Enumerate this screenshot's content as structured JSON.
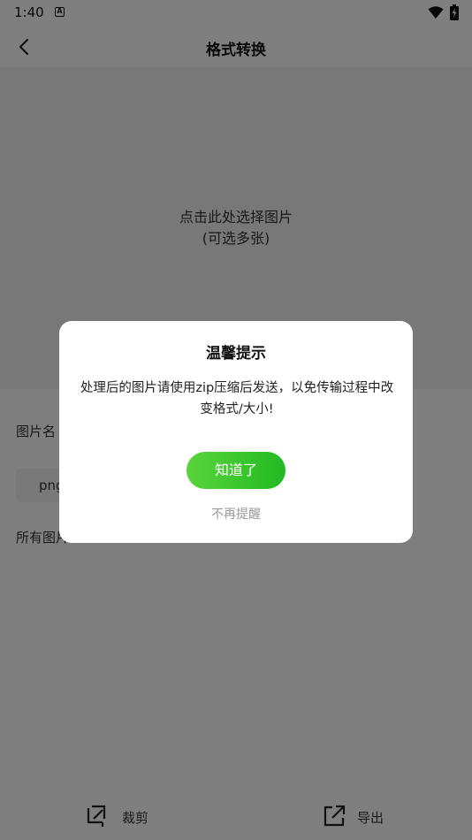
{
  "status_bar": {
    "time": "1:40",
    "notification_letter": "A"
  },
  "header": {
    "title": "格式转换",
    "back_icon": "chevron-left-icon"
  },
  "picker": {
    "line1": "点击此处选择图片",
    "line2": "(可选多张)"
  },
  "settings": {
    "image_name_label": "图片名",
    "format_value": "png",
    "all_images_label": "所有图片"
  },
  "bottom_bar": {
    "crop_label": "裁剪",
    "export_label": "导出"
  },
  "dialog": {
    "title": "温馨提示",
    "message": "处理后的图片请使用zip压缩后发送，以免传输过程中改变格式/大小!",
    "ok_label": "知道了",
    "no_remind_label": "不再提醒"
  },
  "colors": {
    "accent_green": "#22b922",
    "overlay": "rgba(0,0,0,0.5)"
  }
}
